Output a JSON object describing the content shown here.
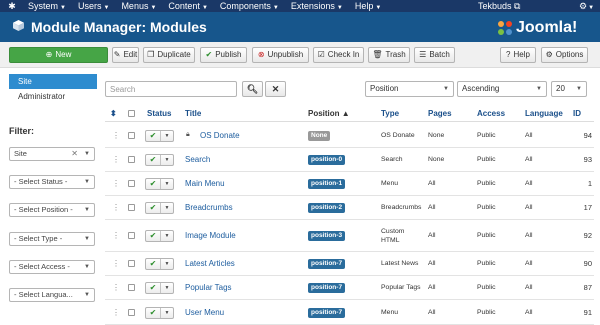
{
  "topnav": {
    "menus": [
      "System",
      "Users",
      "Menus",
      "Content",
      "Components",
      "Extensions",
      "Help"
    ],
    "user": "Tekbuds",
    "user_icon": "external-link-icon",
    "settings_icon": "gear-icon"
  },
  "header": {
    "title": "Module Manager: Modules",
    "brand": "Joomla!"
  },
  "toolbar": {
    "new": "New",
    "edit": "Edit",
    "duplicate": "Duplicate",
    "publish": "Publish",
    "unpublish": "Unpublish",
    "checkin": "Check In",
    "trash": "Trash",
    "batch": "Batch",
    "help": "Help",
    "options": "Options"
  },
  "sidebar": {
    "items": [
      "Site",
      "Administrator"
    ],
    "active": "Site",
    "filter_label": "Filter:",
    "filters": [
      "Site",
      "- Select Status -",
      "- Select Position -",
      "- Select Type -",
      "- Select Access -",
      "- Select Langua..."
    ]
  },
  "search": {
    "placeholder": "Search",
    "value": ""
  },
  "list_controls": {
    "ordering": "Position",
    "direction": "Ascending",
    "limit": "20"
  },
  "table": {
    "headers": {
      "status": "Status",
      "title": "Title",
      "position": "Position",
      "type": "Type",
      "pages": "Pages",
      "access": "Access",
      "language": "Language",
      "id": "ID"
    },
    "sort_icon": "sort-ascending-icon",
    "rows": [
      {
        "title": "OS Donate",
        "locked": true,
        "position": "None",
        "type": "OS Donate",
        "pages": "None",
        "access": "Public",
        "language": "All",
        "id": "94"
      },
      {
        "title": "Search",
        "locked": false,
        "position": "position-0",
        "type": "Search",
        "pages": "None",
        "access": "Public",
        "language": "All",
        "id": "93"
      },
      {
        "title": "Main Menu",
        "locked": false,
        "position": "position-1",
        "type": "Menu",
        "pages": "All",
        "access": "Public",
        "language": "All",
        "id": "1"
      },
      {
        "title": "Breadcrumbs",
        "locked": false,
        "position": "position-2",
        "type": "Breadcrumbs",
        "pages": "All",
        "access": "Public",
        "language": "All",
        "id": "17"
      },
      {
        "title": "Image Module",
        "locked": false,
        "position": "position-3",
        "type": "Custom\nHTML",
        "pages": "All",
        "access": "Public",
        "language": "All",
        "id": "92"
      },
      {
        "title": "Latest Articles",
        "locked": false,
        "position": "position-7",
        "type": "Latest News",
        "pages": "All",
        "access": "Public",
        "language": "All",
        "id": "90"
      },
      {
        "title": "Popular Tags",
        "locked": false,
        "position": "position-7",
        "type": "Popular Tags",
        "pages": "All",
        "access": "Public",
        "language": "All",
        "id": "87"
      },
      {
        "title": "User Menu",
        "locked": false,
        "position": "position-7",
        "type": "Menu",
        "pages": "All",
        "access": "Public",
        "language": "All",
        "id": "91"
      }
    ]
  },
  "colors": {
    "nav": "#1a3867",
    "titlebar": "#17568c",
    "new_button": "#46a546",
    "sidebar_active": "#2e8ccf",
    "position_badge": "#2a6c9c",
    "link": "#1c5c9e"
  }
}
